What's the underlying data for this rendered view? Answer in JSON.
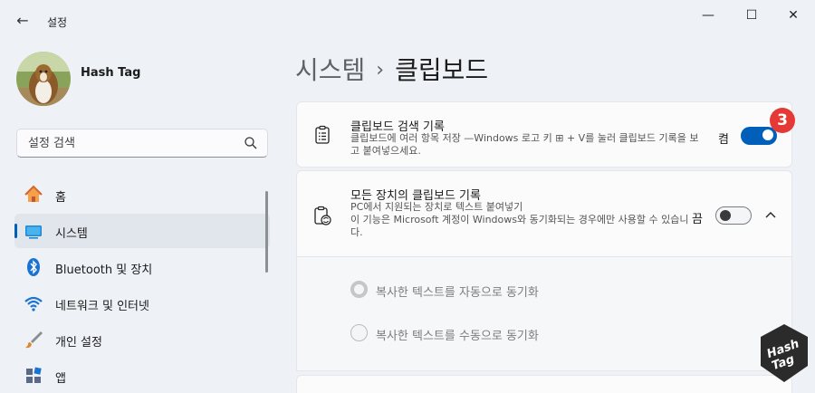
{
  "window": {
    "title": "설정",
    "back_label": "←",
    "minimize": "—",
    "maximize": "☐",
    "close": "✕"
  },
  "user": {
    "name": "Hash Tag"
  },
  "search": {
    "placeholder": "설정 검색"
  },
  "nav": {
    "items": [
      {
        "label": "홈",
        "icon": "home-icon"
      },
      {
        "label": "시스템",
        "icon": "system-icon",
        "selected": true
      },
      {
        "label": "Bluetooth 및 장치",
        "icon": "bluetooth-icon"
      },
      {
        "label": "네트워크 및 인터넷",
        "icon": "wifi-icon"
      },
      {
        "label": "개인 설정",
        "icon": "brush-icon"
      },
      {
        "label": "앱",
        "icon": "apps-icon"
      }
    ]
  },
  "breadcrumb": {
    "parent": "시스템",
    "separator": "›",
    "current": "클립보드"
  },
  "clipboard_history": {
    "title": "클립보드 검색 기록",
    "description": "클립보드에 여러 항목 저장 —Windows 로고 키 ⊞ + V를 눌러 클립보드 기록을 보고 붙여넣으세요.",
    "state_label": "켬",
    "state": "on",
    "badge": "3"
  },
  "sync_devices": {
    "title": "모든 장치의 클립보드 기록",
    "description": "PC에서 지원되는 장치로 텍스트 붙여넣기\n이 기능은 Microsoft 계정이 Windows와 동기화되는 경우에만 사용할 수 있습니다.",
    "state_label": "끔",
    "state": "off",
    "options": [
      {
        "label": "복사한 텍스트를 자동으로 동기화",
        "selected": true
      },
      {
        "label": "복사한 텍스트를 수동으로 동기화",
        "selected": false
      }
    ]
  },
  "watermark": {
    "text_line1": "Hash",
    "text_line2": "Tag"
  },
  "colors": {
    "accent": "#005fb8",
    "badge": "#e53935",
    "background": "#eef1f6"
  }
}
